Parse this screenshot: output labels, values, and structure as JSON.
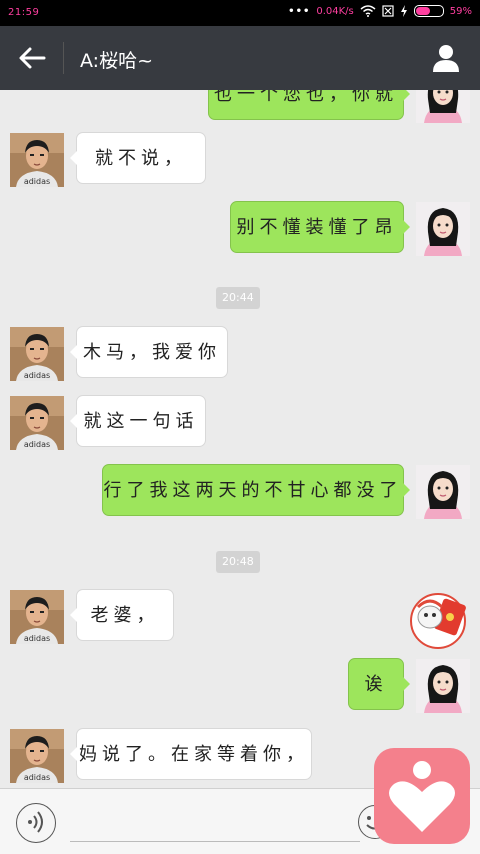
{
  "status_bar": {
    "time": "21:59",
    "network_speed": "0.04K/s",
    "battery_percent": "59%",
    "battery_level": 0.59
  },
  "header": {
    "title": "A:桜哈~",
    "back_icon": "arrow-left-icon",
    "contact_icon": "person-icon"
  },
  "messages": [
    {
      "side": "right",
      "text": "也一个您也，你就"
    },
    {
      "side": "left",
      "text": "就不说，"
    },
    {
      "side": "right",
      "text": "别不懂装懂了昂"
    },
    {
      "type": "time",
      "text": "20:44"
    },
    {
      "side": "left",
      "text": "木马，我爱你"
    },
    {
      "side": "left",
      "text": "就这一句话"
    },
    {
      "side": "right",
      "text": "行了我这两天的不甘心都没了"
    },
    {
      "type": "time",
      "text": "20:48"
    },
    {
      "side": "left",
      "text": "老婆，"
    },
    {
      "side": "right",
      "text": "诶"
    },
    {
      "side": "left",
      "text": "妈说了。在家等着你，"
    }
  ],
  "input_bar": {
    "voice_icon": "voice-icon",
    "emoji_icon": "emoji-icon"
  },
  "floating": {
    "red_packet_icon": "red-packet-icon",
    "heart_icon": "heart-icon"
  },
  "colors": {
    "my_bubble": "#9de55c",
    "their_bubble": "#ffffff",
    "header_bg": "#373a40",
    "chat_bg": "#ebebeb"
  }
}
